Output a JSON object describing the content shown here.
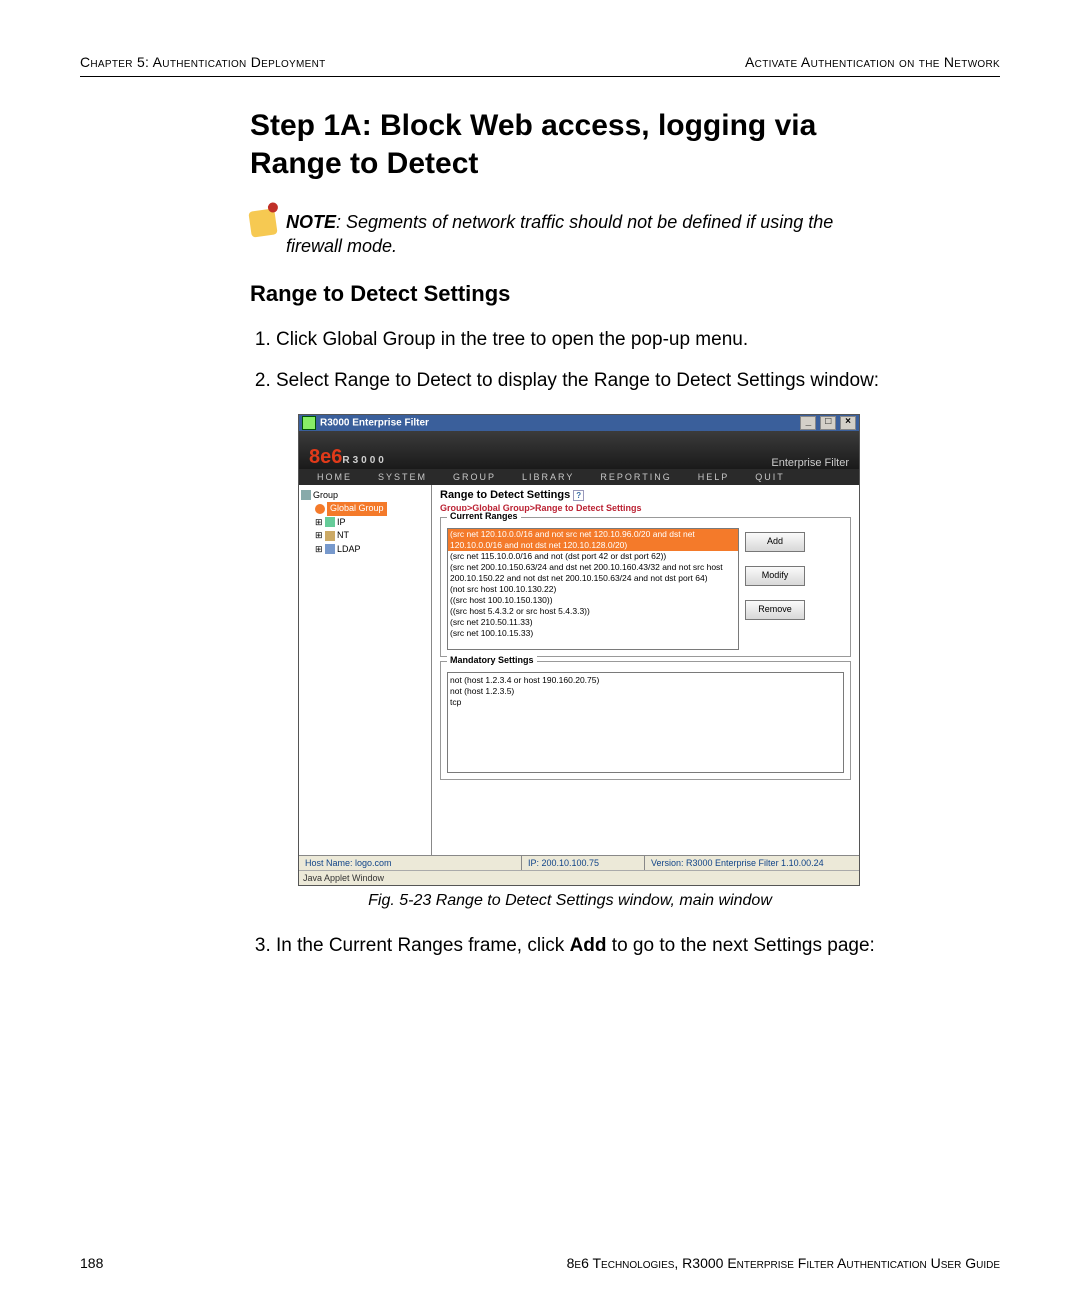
{
  "header": {
    "left": "Chapter 5: Authentication Deployment",
    "right": "Activate Authentication on the Network"
  },
  "h1": "Step 1A: Block Web access, logging via Range to Detect",
  "note": {
    "label": "NOTE",
    "text": ": Segments of network traffic should not be defined if using the firewall mode."
  },
  "h2": "Range to Detect Settings",
  "steps": {
    "s1": "Click Global Group in the tree to open the pop-up menu.",
    "s2": "Select Range to Detect to display the Range to Detect Settings window:",
    "s3_a": "In the Current Ranges frame, click ",
    "s3_b": "Add",
    "s3_c": " to go to the next Settings page:"
  },
  "figcap": "Fig. 5-23  Range to Detect Settings window, main window",
  "app": {
    "title": "R3000 Enterprise Filter",
    "brand_left": "8e6",
    "brand_sub": "R3000",
    "brand_right": "Enterprise Filter",
    "menu": {
      "home": "HOME",
      "system": "SYSTEM",
      "group": "GROUP",
      "library": "LIBRARY",
      "reporting": "REPORTING",
      "help": "HELP",
      "quit": "QUIT"
    },
    "tree": {
      "root": "Group",
      "global": "Global Group",
      "ip": "IP",
      "nt": "NT",
      "ldap": "LDAP"
    },
    "main_title": "Range to Detect Settings",
    "crumb": "Group>Global Group>Range to Detect Settings",
    "current_ranges_label": "Current Ranges",
    "ranges": [
      "(src net 120.10.0.0/16 and not src net 120.10.96.0/20 and dst net 120.10.0.0/16 and not dst net 120.10.128.0/20)",
      "(src net 115.10.0.0/16 and not (dst port 42 or dst port 62))",
      "(src net 200.10.150.63/24 and dst net 200.10.160.43/32 and not src host 200.10.150.22 and not dst net 200.10.150.63/24 and not dst port 64)",
      "(not src host 100.10.130.22)",
      "((src host 100.10.150.130))",
      "((src host 5.4.3.2 or src host 5.4.3.3))",
      "(src net 210.50.11.33)",
      "(src net 100.10.15.33)"
    ],
    "buttons": {
      "add": "Add",
      "modify": "Modify",
      "remove": "Remove"
    },
    "mandatory_label": "Mandatory Settings",
    "mandatory": [
      "not (host 1.2.3.4 or host 190.160.20.75)",
      "not (host 1.2.3.5)",
      "tcp"
    ],
    "status": {
      "host": "Host Name: logo.com",
      "ip": "IP: 200.10.100.75",
      "version": "Version: R3000 Enterprise Filter 1.10.00.24"
    },
    "java": "Java Applet Window"
  },
  "footer": {
    "page": "188",
    "line": "8e6 Technologies, R3000 Enterprise Filter Authentication User Guide"
  }
}
